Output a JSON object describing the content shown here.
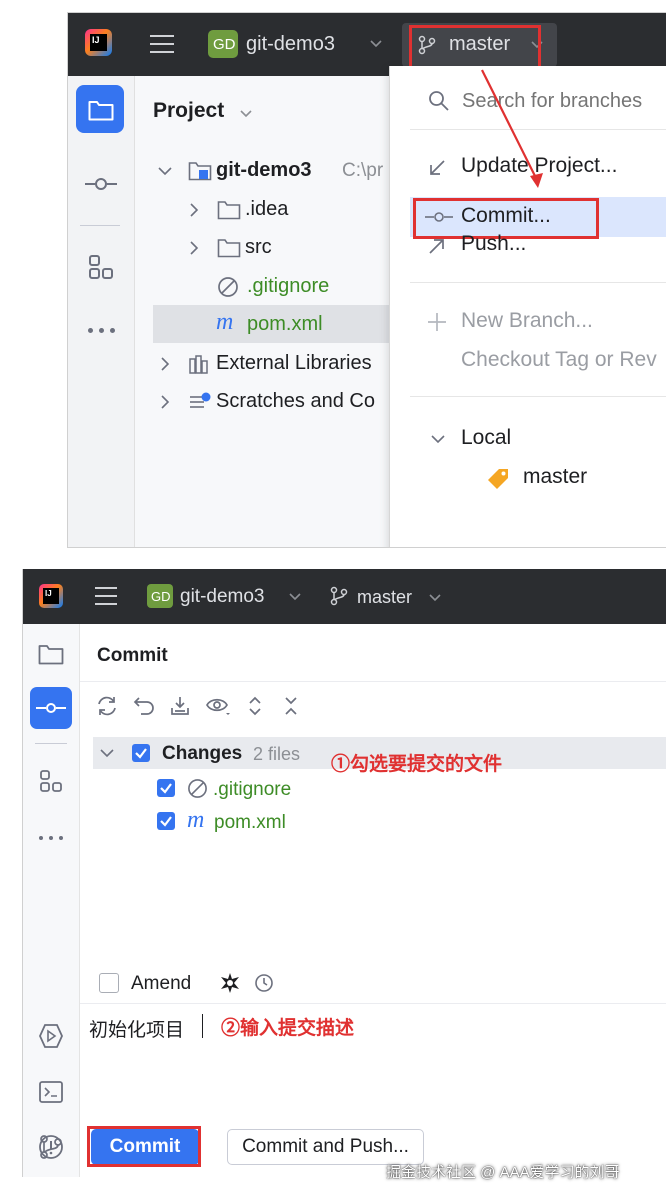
{
  "top": {
    "logo": "IJ",
    "project_badge": "GD",
    "project_name": "git-demo3",
    "branch": "master",
    "sidebar_icons": [
      "folder-icon",
      "commit-icon",
      "structure-icon",
      "more-icon"
    ],
    "project_header": "Project",
    "tree": [
      {
        "label": "git-demo3",
        "suffix": "C:\\pr"
      },
      {
        "label": ".idea"
      },
      {
        "label": "src"
      },
      {
        "label": ".gitignore"
      },
      {
        "label": "pom.xml",
        "prefix": "m"
      },
      {
        "label": "External Libraries"
      },
      {
        "label": "Scratches and Co"
      }
    ],
    "popup": {
      "search_placeholder": "Search for branches",
      "items": [
        "Update Project...",
        "Commit...",
        "Push..."
      ],
      "new_branch": "New Branch...",
      "checkout_tag": "Checkout Tag or Rev",
      "local_header": "Local",
      "local_branch": "master"
    }
  },
  "bottom": {
    "logo": "IJ",
    "project_badge": "GD",
    "project_name": "git-demo3",
    "branch": "master",
    "panel_title": "Commit",
    "changes_label": "Changes",
    "changes_count": "2 files",
    "files": [
      {
        "name": ".gitignore"
      },
      {
        "name": "pom.xml",
        "prefix": "m"
      }
    ],
    "annotation_1": "①勾选要提交的文件",
    "amend_label": "Amend",
    "commit_message": "初始化项目",
    "annotation_2": "②输入提交描述",
    "commit_button": "Commit",
    "commit_push_button": "Commit and Push...",
    "watermark": "掘金技术社区 @ AAA爱学习的刘哥"
  },
  "colors": {
    "accent": "#3574f0",
    "annotation_red": "#e03131",
    "dark_bar": "#2b2d30",
    "file_added_green": "#3d8c26",
    "selection": "#dbe6fd"
  }
}
